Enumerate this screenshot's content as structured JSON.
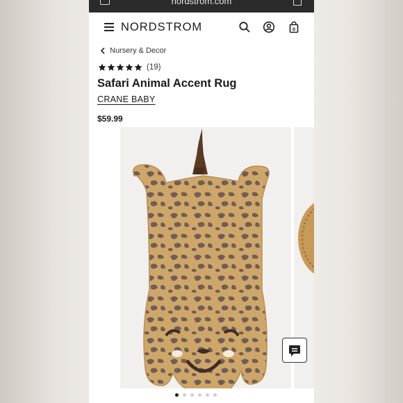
{
  "browser": {
    "url": "nordstrom.com"
  },
  "header": {
    "logo": "NORDSTROM"
  },
  "breadcrumb": {
    "label": "Nursery & Decor"
  },
  "product": {
    "rating_stars": 5,
    "review_count": "(19)",
    "title": "Safari Animal Accent Rug",
    "brand": "CRANE BABY",
    "price": "$59.99"
  },
  "gallery": {
    "image_count": 6,
    "active_index": 0
  },
  "icons": {
    "menu": "hamburger-icon",
    "search": "search-icon",
    "account": "account-icon",
    "bag": "shopping-bag-icon",
    "chat": "chat-icon",
    "back": "chevron-left-icon"
  },
  "colors": {
    "bag_count": "0"
  }
}
